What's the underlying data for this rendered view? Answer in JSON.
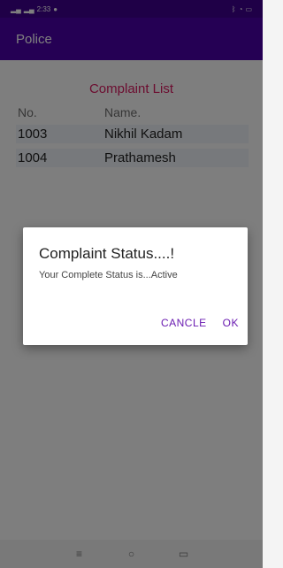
{
  "status_bar": {
    "time": "2:33",
    "notification_icon": "alert-icon"
  },
  "app_bar": {
    "title": "Police"
  },
  "list": {
    "title": "Complaint List",
    "headers": [
      "No.",
      "Name."
    ],
    "rows": [
      {
        "no": "1003",
        "name": "Nikhil Kadam"
      },
      {
        "no": "1004",
        "name": "Prathamesh"
      }
    ]
  },
  "dialog": {
    "title": "Complaint Status....!",
    "message": "Your Complete Status is...Active",
    "cancel_label": "CANCLE",
    "ok_label": "OK"
  },
  "nav": {
    "menu_icon": "menu-icon",
    "home_icon": "home-icon",
    "back_icon": "back-icon"
  },
  "colors": {
    "app_bar": "#4a00a8",
    "accent": "#d81b60",
    "dialog_button": "#6a1bb1"
  }
}
